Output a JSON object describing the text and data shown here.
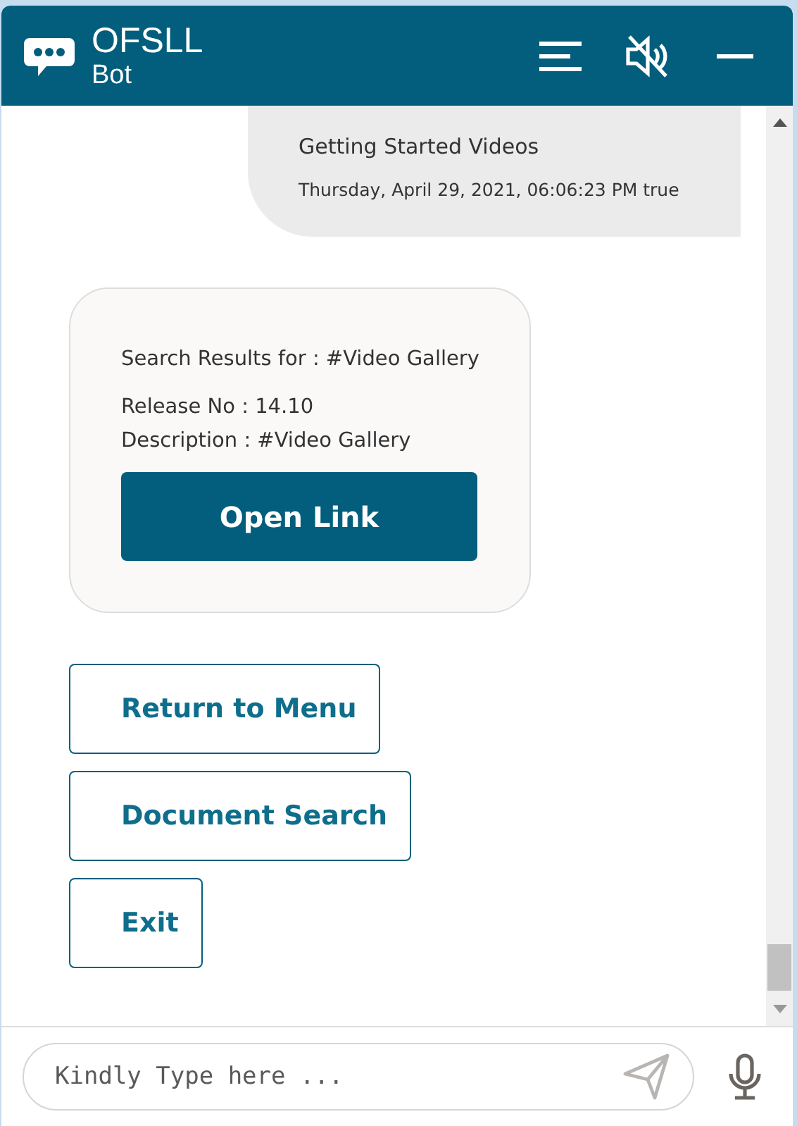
{
  "header": {
    "title": "OFSLL",
    "subtitle": "Bot",
    "muted": true
  },
  "messages": [
    {
      "kind": "user",
      "text": "Getting Started Videos",
      "time": "Thursday, April 29, 2021, 06:06:23 PM true"
    },
    {
      "kind": "card",
      "lines": [
        "Search Results for : #Video Gallery",
        "Release No : 14.10",
        "Description : #Video Gallery"
      ],
      "button": "Open Link"
    }
  ],
  "actions": [
    "Return to Menu",
    "Document Search",
    "Exit"
  ],
  "input": {
    "placeholder": "Kindly Type here ..."
  }
}
